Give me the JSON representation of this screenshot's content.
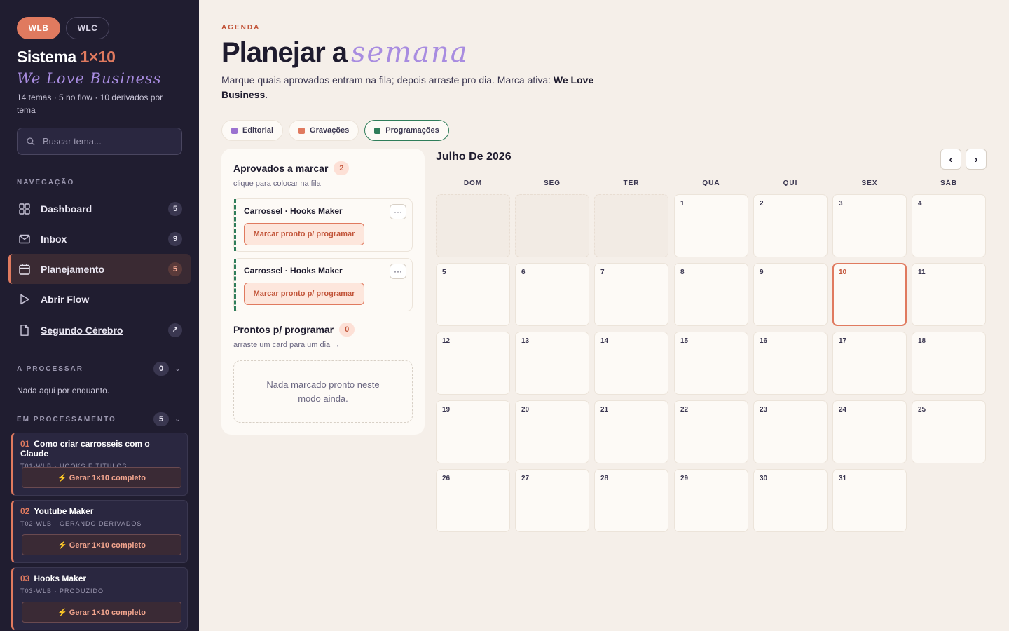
{
  "sidebar": {
    "brands": [
      {
        "label": "WLB"
      },
      {
        "label": "WLC"
      }
    ],
    "title_main": "Sistema ",
    "title_accent": "1×10",
    "subtitle": "We Love Business",
    "meta": "14 temas · 5 no flow · 10 derivados por tema",
    "search_placeholder": "Buscar tema...",
    "nav_label": "NAVEGAÇÃO",
    "nav": [
      {
        "label": "Dashboard",
        "badge": "5"
      },
      {
        "label": "Inbox",
        "badge": "9"
      },
      {
        "label": "Planejamento",
        "badge": "5"
      },
      {
        "label": "Abrir Flow"
      },
      {
        "label": "Segundo Cérebro",
        "ext": "↗"
      }
    ],
    "processing_label": "A PROCESSAR",
    "processing_count": "0",
    "processing_empty": "Nada aqui por enquanto.",
    "in_progress_label": "EM PROCESSAMENTO",
    "in_progress_count": "5",
    "cards": [
      {
        "num": "01",
        "title": "Como criar carrosseis com o Claude",
        "meta": "T01-WLB · HOOKS E TÍTULOS",
        "button": "⚡ Gerar 1×10 completo"
      },
      {
        "num": "02",
        "title": "Youtube Maker",
        "meta": "T02-WLB · GERANDO DERIVADOS",
        "button": "⚡ Gerar 1×10 completo"
      },
      {
        "num": "03",
        "title": "Hooks Maker",
        "meta": "T03-WLB · PRODUZIDO",
        "button": "⚡ Gerar 1×10 completo"
      }
    ]
  },
  "main": {
    "eyebrow": "AGENDA",
    "title": "Planejar a",
    "title_script": "semana",
    "desc_pre": "Marque quais aprovados entram na fila; depois arraste pro dia. Marca ativa: ",
    "desc_brand": "We Love Business",
    "desc_post": ".",
    "filters": [
      {
        "label": "Editorial",
        "color": "#9b72d0"
      },
      {
        "label": "Gravações",
        "color": "#e07a5f"
      },
      {
        "label": "Programações",
        "color": "#2f7d5a"
      }
    ]
  },
  "queue": {
    "approved_title": "Aprovados a marcar",
    "approved_count": "2",
    "approved_hint": "clique para colocar na fila",
    "cards": [
      {
        "title": "Carrossel · Hooks Maker",
        "button": "Marcar pronto p/ programar",
        "more": "···"
      },
      {
        "title": "Carrossel · Hooks Maker",
        "button": "Marcar pronto p/ programar",
        "more": "···"
      }
    ],
    "ready_title": "Prontos p/ programar",
    "ready_count": "0",
    "ready_hint": "arraste um card para um dia →",
    "empty": "Nada marcado pronto neste modo ainda."
  },
  "calendar": {
    "month": "Julho De 2026",
    "prev": "‹",
    "next": "›",
    "weekdays": [
      "DOM",
      "SEG",
      "TER",
      "QUA",
      "QUI",
      "SEX",
      "SÁB"
    ],
    "first_weekday": 3,
    "days_in_month": 31,
    "today": 10
  },
  "colors": {
    "accent": "#e07a5f",
    "sidebar_bg": "#201d30",
    "page_bg": "#f5efe9",
    "script": "#a88ce0",
    "green": "#2f7d5a"
  }
}
